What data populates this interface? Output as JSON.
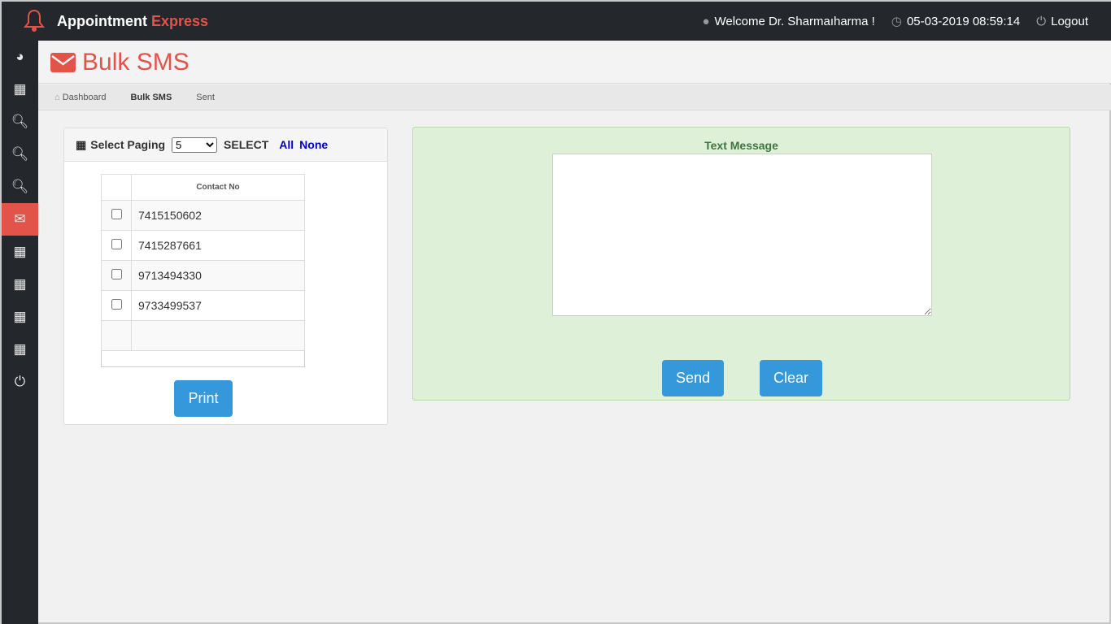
{
  "app": {
    "title_main": "Appointment",
    "title_accent": "Express"
  },
  "topbar": {
    "welcome": "Welcome Dr. Sharmaıharma !",
    "datetime": "05-03-2019 08:59:14",
    "logout": "Logout"
  },
  "sidebar": {
    "items": [
      {
        "icon": "dashboard-icon"
      },
      {
        "icon": "calendar-icon"
      },
      {
        "icon": "search-icon"
      },
      {
        "icon": "search-icon"
      },
      {
        "icon": "search-icon"
      },
      {
        "icon": "envelope-icon",
        "active": true
      },
      {
        "icon": "calendar-icon"
      },
      {
        "icon": "calendar-icon"
      },
      {
        "icon": "calendar-icon"
      },
      {
        "icon": "calendar-icon"
      },
      {
        "icon": "power-icon"
      }
    ]
  },
  "page": {
    "title": "Bulk SMS"
  },
  "breadcrumb": [
    "Dashboard",
    "Bulk SMS",
    "Sent"
  ],
  "contacts": {
    "select_paging_label": "Select Paging",
    "paging_value": "5",
    "select_label": "SELECT",
    "all": "All",
    "none": "None",
    "column": "Contact No",
    "rows": [
      "7415150602",
      "7415287661",
      "9713494330",
      "9733499537"
    ],
    "print": "Print"
  },
  "message": {
    "label": "Text Message",
    "value": "",
    "send": "Send",
    "clear": "Clear"
  },
  "colors": {
    "accent": "#e2534a",
    "button": "#3498db",
    "panel_green": "#dff0d8",
    "dark": "#24272b"
  }
}
